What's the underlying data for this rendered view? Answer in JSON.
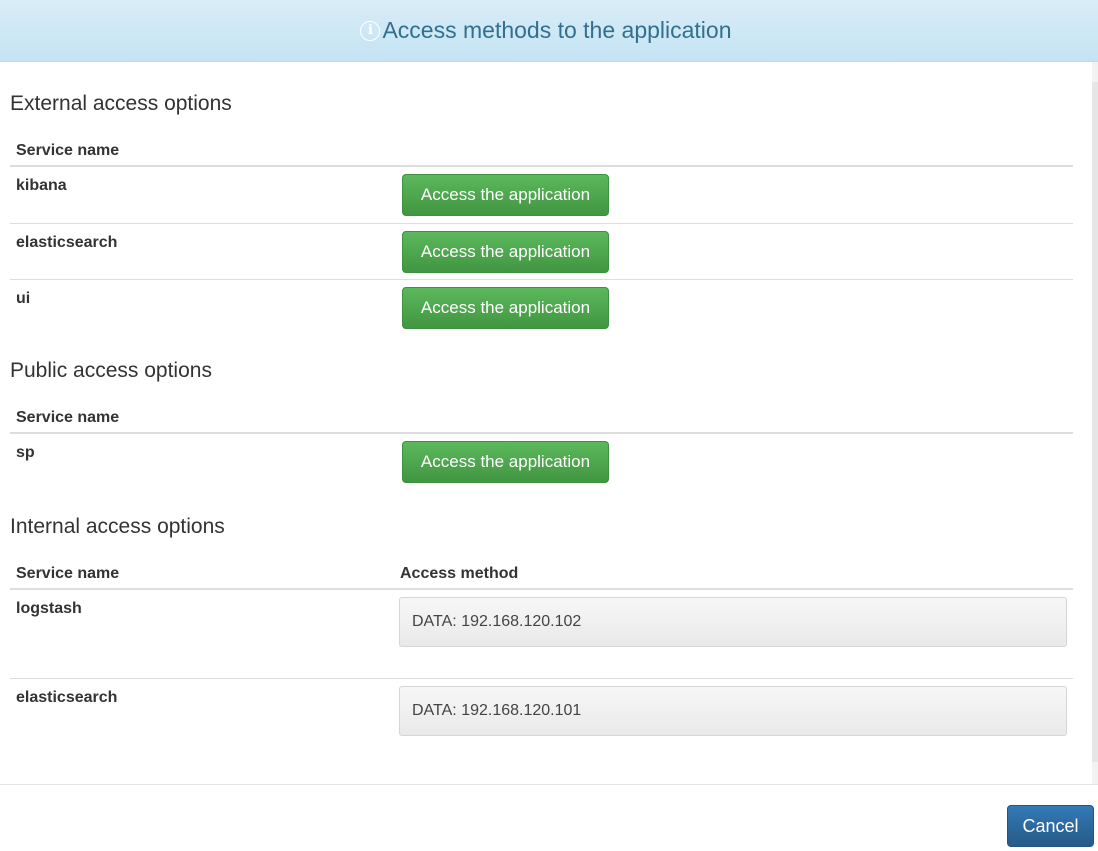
{
  "header": {
    "icon": "info-icon",
    "title": "Access methods to the application"
  },
  "external": {
    "title": "External access options",
    "col_service": "Service name",
    "rows": [
      {
        "name": "kibana",
        "button": "Access the application"
      },
      {
        "name": "elasticsearch",
        "button": "Access the application"
      },
      {
        "name": "ui",
        "button": "Access the application"
      }
    ]
  },
  "public": {
    "title": "Public access options",
    "col_service": "Service name",
    "rows": [
      {
        "name": "sp",
        "button": "Access the application"
      }
    ]
  },
  "internal": {
    "title": "Internal access options",
    "col_service": "Service name",
    "col_method": "Access method",
    "rows": [
      {
        "name": "logstash",
        "method": "DATA: 192.168.120.102"
      },
      {
        "name": "elasticsearch",
        "method": "DATA: 192.168.120.101"
      }
    ]
  },
  "footer": {
    "cancel_label": "Cancel"
  },
  "colors": {
    "header_bg": "#d9edf7",
    "header_text": "#31708f",
    "success": "#5cb85c",
    "primary": "#337ab7"
  }
}
